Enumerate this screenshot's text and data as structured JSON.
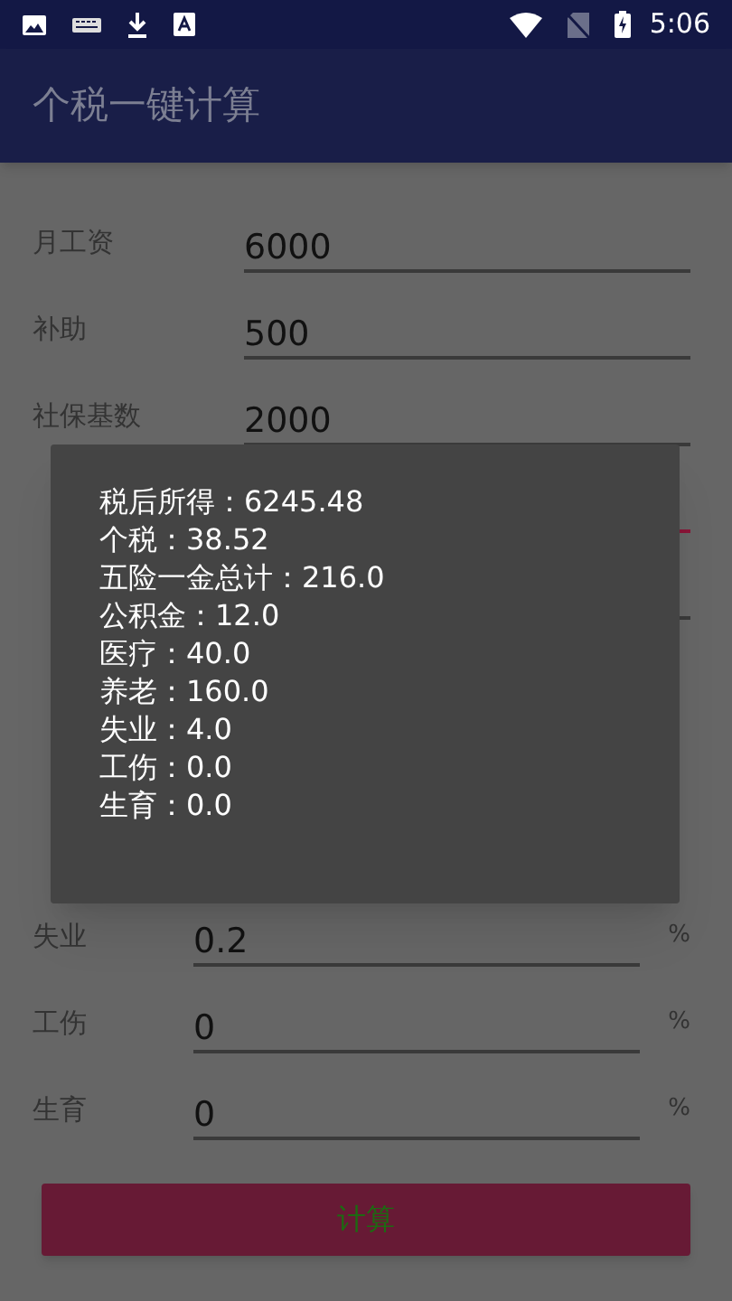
{
  "status_bar": {
    "time": "5:06"
  },
  "app_bar": {
    "title": "个税一键计算"
  },
  "form": {
    "rows": [
      {
        "label": "月工资",
        "value": "6000",
        "focused": false
      },
      {
        "label": "补助",
        "value": "500",
        "focused": false
      },
      {
        "label": "社保基数",
        "value": "2000",
        "focused": false
      },
      {
        "focused": true
      },
      {
        "focused": false
      },
      {},
      {},
      {},
      {
        "label": "失业",
        "value": "0.2",
        "unit": "%",
        "focused": false
      },
      {
        "label": "工伤",
        "value": "0",
        "unit": "%",
        "focused": false
      },
      {
        "label": "生育",
        "value": "0",
        "unit": "%",
        "focused": false
      }
    ]
  },
  "calculate_button": {
    "label": "计算"
  },
  "result_dialog": {
    "lines": [
      "税后所得：6245.48",
      "个税：38.52",
      "五险一金总计：216.0",
      "公积金：12.0",
      "医疗：40.0",
      "养老：160.0",
      "失业：4.0",
      "工伤：0.0",
      "生育：0.0"
    ]
  }
}
